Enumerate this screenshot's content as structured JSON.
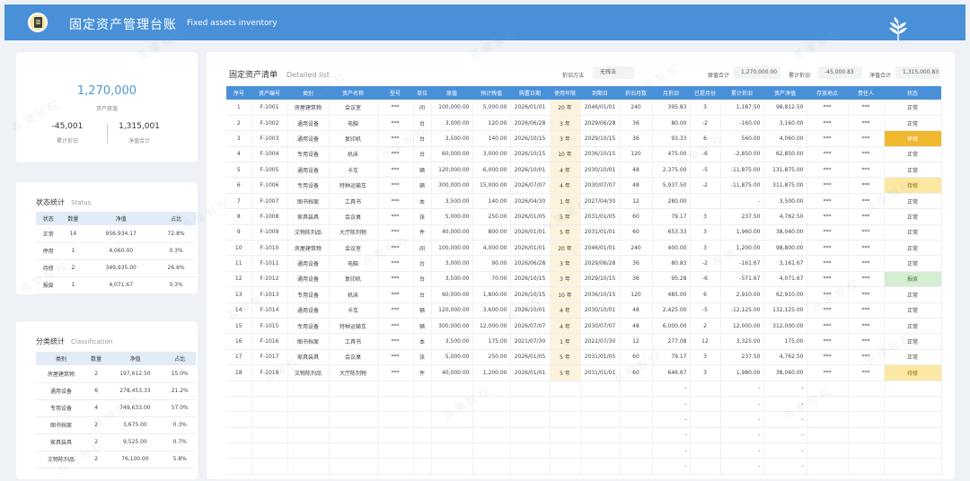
{
  "header": {
    "title_cn": "固定资产管理台账",
    "title_en": "Fixed assets inventory"
  },
  "summary": {
    "total_value": "1,270,000",
    "total_label": "资产原值",
    "depr_value": "-45,001",
    "depr_label": "累计折旧",
    "net_value": "1,315,001",
    "net_label": "净值合计"
  },
  "status": {
    "title": "状态统计",
    "title_en": "Status",
    "headers": [
      "状态",
      "数量",
      "净值",
      "占比"
    ],
    "rows": [
      [
        "正常",
        "14",
        "956,934.17",
        "72.8%"
      ],
      [
        "停用",
        "1",
        "4,060.00",
        "0.3%"
      ],
      [
        "待修",
        "2",
        "349,935.00",
        "26.6%"
      ],
      [
        "报废",
        "1",
        "4,071.67",
        "0.3%"
      ]
    ]
  },
  "classification": {
    "title": "分类统计",
    "title_en": "Classification",
    "headers": [
      "类别",
      "数量",
      "净值",
      "占比"
    ],
    "rows": [
      [
        "房屋建筑物",
        "2",
        "197,612.50",
        "15.0%"
      ],
      [
        "通用设备",
        "6",
        "278,453.33",
        "21.2%"
      ],
      [
        "专用设备",
        "4",
        "749,633.00",
        "57.0%"
      ],
      [
        "图书档案",
        "2",
        "3,675.00",
        "0.3%"
      ],
      [
        "家具装具",
        "2",
        "9,525.00",
        "0.7%"
      ],
      [
        "文物陈列品",
        "2",
        "76,100.00",
        "5.8%"
      ]
    ]
  },
  "main": {
    "title": "固定资产清单",
    "title_en": "Detailed list",
    "method_label": "折旧方法",
    "method_value": "无残法",
    "orig_label": "原值合计",
    "orig_value": "1,270,000.00",
    "depr_label": "累计折旧",
    "depr_value": "-45,000.83",
    "net_label": "净值合计",
    "net_value": "1,315,000.83",
    "headers": [
      "序号",
      "资产编号",
      "类别",
      "资产名称",
      "型号",
      "单位",
      "原值",
      "预计残值",
      "购置日期",
      "使用年限",
      "到期日",
      "折旧月数",
      "月折旧",
      "已提月份",
      "累计折旧",
      "资产净值",
      "存放地点",
      "责任人",
      "状态"
    ],
    "rows": [
      [
        "1",
        "F-1001",
        "房屋建筑物",
        "会议室",
        "***",
        "间",
        "100,000.00",
        "5,000.00",
        "2026/01/01",
        "20 年",
        "2046/01/01",
        "240",
        "395.83",
        "3",
        "1,187.50",
        "98,812.50",
        "***",
        "***",
        "正常"
      ],
      [
        "2",
        "F-1002",
        "通用设备",
        "电脑",
        "***",
        "台",
        "3,000.00",
        "120.00",
        "2026/06/28",
        "3 年",
        "2029/06/28",
        "36",
        "80.00",
        "-2",
        "-160.00",
        "3,160.00",
        "***",
        "***",
        "正常"
      ],
      [
        "3",
        "F-1003",
        "通用设备",
        "复印机",
        "***",
        "台",
        "3,500.00",
        "140.00",
        "2026/10/15",
        "3 年",
        "2029/10/15",
        "36",
        "93.33",
        "6",
        "560.00",
        "4,060.00",
        "***",
        "***",
        "停用"
      ],
      [
        "4",
        "F-1004",
        "专用设备",
        "机床",
        "***",
        "台",
        "60,000.00",
        "3,000.00",
        "2026/10/15",
        "10 年",
        "2036/10/15",
        "120",
        "475.00",
        "-6",
        "-2,850.00",
        "62,850.00",
        "***",
        "***",
        "正常"
      ],
      [
        "5",
        "F-1005",
        "通用设备",
        "卡车",
        "***",
        "辆",
        "120,000.00",
        "6,000.00",
        "2026/10/01",
        "4 年",
        "2030/10/01",
        "48",
        "2,375.00",
        "-5",
        "-11,875.00",
        "131,875.00",
        "***",
        "***",
        "正常"
      ],
      [
        "6",
        "F-1006",
        "专用设备",
        "特种运输车",
        "***",
        "辆",
        "300,000.00",
        "15,000.00",
        "2026/07/07",
        "4 年",
        "2030/07/07",
        "48",
        "5,937.50",
        "-2",
        "-11,875.00",
        "311,875.00",
        "***",
        "***",
        "待修"
      ],
      [
        "7",
        "F-1007",
        "图书档案",
        "工具书",
        "***",
        "本",
        "3,500.00",
        "140.00",
        "2026/04/30",
        "1 年",
        "2027/04/30",
        "12",
        "280.00",
        "",
        "-",
        "3,500.00",
        "***",
        "***",
        "正常"
      ],
      [
        "8",
        "F-1008",
        "家具装具",
        "会议桌",
        "***",
        "张",
        "5,000.00",
        "250.00",
        "2026/01/05",
        "5 年",
        "2031/01/05",
        "60",
        "79.17",
        "3",
        "237.50",
        "4,762.50",
        "***",
        "***",
        "正常"
      ],
      [
        "9",
        "F-1009",
        "文物陈列品",
        "大厅陈列物",
        "***",
        "件",
        "40,000.00",
        "800.00",
        "2026/01/01",
        "5 年",
        "2031/01/01",
        "60",
        "653.33",
        "3",
        "1,960.00",
        "38,040.00",
        "***",
        "***",
        "正常"
      ],
      [
        "10",
        "F-1010",
        "房屋建筑物",
        "会议室",
        "***",
        "间",
        "100,000.00",
        "4,000.00",
        "2026/01/01",
        "20 年",
        "2046/01/01",
        "240",
        "400.00",
        "3",
        "1,200.00",
        "98,800.00",
        "***",
        "***",
        "正常"
      ],
      [
        "11",
        "F-1011",
        "通用设备",
        "电脑",
        "***",
        "台",
        "3,000.00",
        "90.00",
        "2026/06/28",
        "3 年",
        "2029/06/28",
        "36",
        "80.83",
        "-2",
        "-161.67",
        "3,161.67",
        "***",
        "***",
        "正常"
      ],
      [
        "12",
        "F-1012",
        "通用设备",
        "复印机",
        "***",
        "台",
        "3,500.00",
        "70.00",
        "2026/10/15",
        "3 年",
        "2029/10/15",
        "36",
        "95.28",
        "-6",
        "-571.67",
        "4,071.67",
        "***",
        "***",
        "报废"
      ],
      [
        "13",
        "F-1013",
        "专用设备",
        "机床",
        "***",
        "台",
        "60,000.00",
        "1,800.00",
        "2026/10/15",
        "10 年",
        "2036/10/15",
        "120",
        "485.00",
        "6",
        "2,910.00",
        "62,910.00",
        "***",
        "***",
        "正常"
      ],
      [
        "14",
        "F-1014",
        "通用设备",
        "卡车",
        "***",
        "辆",
        "120,000.00",
        "3,600.00",
        "2026/10/01",
        "4 年",
        "2030/10/01",
        "48",
        "2,425.00",
        "-5",
        "-12,125.00",
        "132,125.00",
        "***",
        "***",
        "正常"
      ],
      [
        "15",
        "F-1015",
        "专用设备",
        "特种运输车",
        "***",
        "辆",
        "300,000.00",
        "12,000.00",
        "2026/07/07",
        "4 年",
        "2030/07/07",
        "48",
        "6,000.00",
        "2",
        "12,000.00",
        "312,000.00",
        "***",
        "***",
        "正常"
      ],
      [
        "16",
        "F-1016",
        "图书档案",
        "工具书",
        "***",
        "本",
        "3,500.00",
        "175.00",
        "2021/07/30",
        "1 年",
        "2022/07/30",
        "12",
        "277.08",
        "12",
        "3,325.00",
        "175.00",
        "***",
        "***",
        "正常"
      ],
      [
        "17",
        "F-1017",
        "家具装具",
        "会议桌",
        "***",
        "张",
        "5,000.00",
        "250.00",
        "2026/01/05",
        "5 年",
        "2031/01/05",
        "60",
        "79.17",
        "3",
        "237.50",
        "4,762.50",
        "***",
        "***",
        "正常"
      ],
      [
        "18",
        "F-1018",
        "文物陈列品",
        "大厅陈列物",
        "***",
        "件",
        "40,000.00",
        "1,200.00",
        "2026/01/01",
        "5 年",
        "2031/01/01",
        "60",
        "646.67",
        "3",
        "1,980.00",
        "38,060.00",
        "***",
        "***",
        "待修"
      ],
      [
        "",
        "",
        "",
        "",
        "",
        "",
        "",
        "",
        "",
        "",
        "",
        "",
        "-",
        "",
        "-",
        "-",
        "",
        "",
        ""
      ],
      [
        "",
        "",
        "",
        "",
        "",
        "",
        "",
        "",
        "",
        "",
        "",
        "",
        "-",
        "",
        "-",
        "-",
        "",
        "",
        ""
      ],
      [
        "",
        "",
        "",
        "",
        "",
        "",
        "",
        "",
        "",
        "",
        "",
        "",
        "-",
        "",
        "-",
        "-",
        "",
        "",
        ""
      ],
      [
        "",
        "",
        "",
        "",
        "",
        "",
        "",
        "",
        "",
        "",
        "",
        "",
        "-",
        "",
        "-",
        "-",
        "",
        "",
        ""
      ],
      [
        "",
        "",
        "",
        "",
        "",
        "",
        "",
        "",
        "",
        "",
        "",
        "",
        "-",
        "",
        "-",
        "-",
        "",
        "",
        ""
      ],
      [
        "",
        "",
        "",
        "",
        "",
        "",
        "",
        "",
        "",
        "",
        "",
        "",
        "-",
        "",
        "-",
        "-",
        "",
        "",
        ""
      ]
    ]
  },
  "watermark": "長樂智权",
  "colors": {
    "header_bg": "#4a90d9",
    "accent_text": "#4a9bd1",
    "warn": "#f0b82e",
    "idle": "#fbe8a3",
    "scrap": "#d5edd2",
    "life_bg": "#fdf3dc"
  }
}
